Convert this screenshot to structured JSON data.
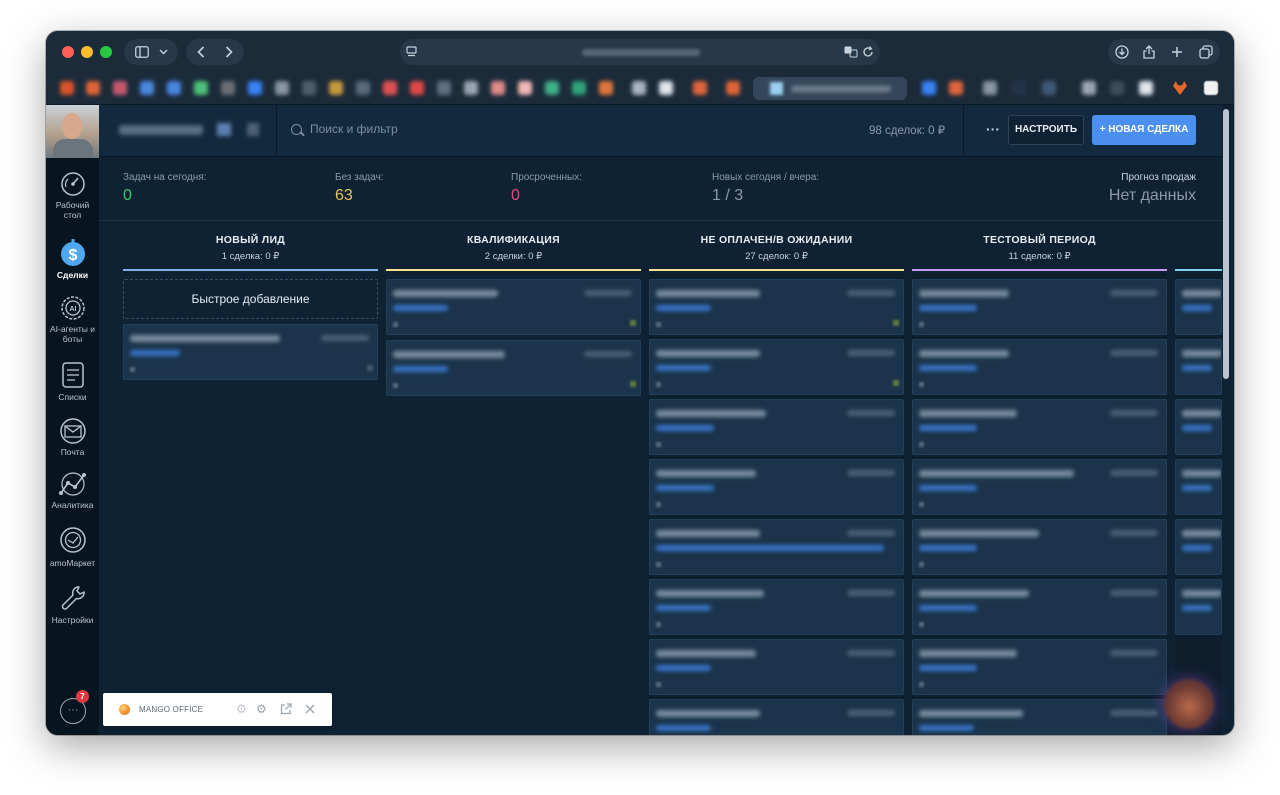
{
  "sidebar": {
    "items": [
      {
        "label": "Рабочий стол",
        "icon": "speedometer-icon"
      },
      {
        "label": "Сделки",
        "icon": "dollar-icon"
      },
      {
        "label": "AI-агенты и боты",
        "icon": "ai-icon"
      },
      {
        "label": "Списки",
        "icon": "list-icon"
      },
      {
        "label": "Почта",
        "icon": "mail-icon"
      },
      {
        "label": "Аналитика",
        "icon": "analytics-icon"
      },
      {
        "label": "amoМаркет",
        "icon": "market-icon"
      },
      {
        "label": "Настройки",
        "icon": "wrench-icon"
      }
    ],
    "chat_badge": "7"
  },
  "header": {
    "search_placeholder": "Поиск и фильтр",
    "deals_count": "98 сделок: 0 ₽",
    "more": "···",
    "setup_label": "НАСТРОИТЬ",
    "new_deal_label": "+ НОВАЯ СДЕЛКА"
  },
  "stats": {
    "tasks_today": {
      "label": "Задач на сегодня:",
      "value": "0",
      "color": "#2ecc71"
    },
    "no_tasks": {
      "label": "Без задач:",
      "value": "63",
      "color": "#e6c35c"
    },
    "overdue": {
      "label": "Просроченных:",
      "value": "0",
      "color": "#e84a7c"
    },
    "new": {
      "label": "Новых сегодня / вчера:",
      "value": "1 / 3",
      "color": "#8b9aab"
    },
    "forecast": {
      "label": "Прогноз продаж",
      "value": "Нет данных",
      "color": "#8b9aab"
    }
  },
  "board": {
    "quick_add": "Быстрое добавление",
    "columns": [
      {
        "title": "НОВЫЙ ЛИД",
        "sub": "1 сделка: 0 ₽",
        "color": "#7fb1e6"
      },
      {
        "title": "КВАЛИФИКАЦИЯ",
        "sub": "2 сделки: 0 ₽",
        "color": "#f2e38c"
      },
      {
        "title": "НЕ ОПЛАЧЕН/В ОЖИДАНИИ",
        "sub": "27 сделок: 0 ₽",
        "color": "#f2e38c"
      },
      {
        "title": "ТЕСТОВЫЙ ПЕРИОД",
        "sub": "11 сделок: 0 ₽",
        "color": "#c29bf0"
      }
    ]
  },
  "widget": {
    "name": "MANGO OFFICE"
  }
}
